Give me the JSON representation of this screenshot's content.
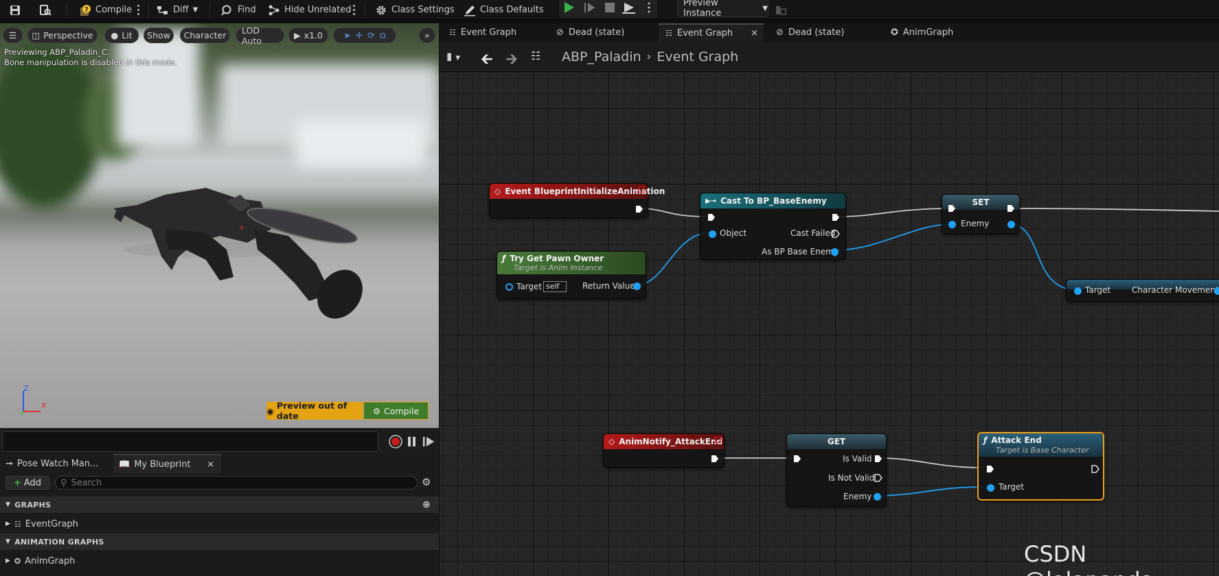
{
  "toolbar": {
    "compile_label": "Compile",
    "diff_label": "Diff",
    "find_label": "Find",
    "hide_unrelated_label": "Hide Unrelated",
    "class_settings_label": "Class Settings",
    "class_defaults_label": "Class Defaults",
    "preview_instance_label": "Preview Instance"
  },
  "viewport": {
    "perspective_label": "Perspective",
    "lit_label": "Lit",
    "show_label": "Show",
    "character_label": "Character",
    "lod_label": "LOD Auto",
    "speed_label": "x1.0",
    "preview_line1": "Previewing ABP_Paladin_C.",
    "preview_line2": "Bone manipulation is disabled in this mode.",
    "axis_z": "Z",
    "axis_x": "X",
    "preview_out_of_date": "Preview out of date",
    "compile_label": "Compile"
  },
  "left_panel": {
    "tabs": [
      {
        "label": "Pose Watch Man..."
      },
      {
        "label": "My Blueprint"
      }
    ],
    "add_label": "Add",
    "search_placeholder": "Search",
    "sections": [
      {
        "title": "GRAPHS",
        "items": [
          {
            "label": "EventGraph"
          }
        ]
      },
      {
        "title": "ANIMATION GRAPHS",
        "items": [
          {
            "label": "AnimGraph"
          }
        ]
      }
    ]
  },
  "graph": {
    "tabs": [
      {
        "label": "Event Graph"
      },
      {
        "label": "Dead (state)"
      },
      {
        "label": "Event Graph"
      },
      {
        "label": "Dead (state)"
      },
      {
        "label": "AnimGraph"
      }
    ],
    "breadcrumb": {
      "root": "ABP_Paladin",
      "current": "Event Graph"
    },
    "nodes": {
      "event_init": {
        "title": "Event BlueprintInitializeAnimation"
      },
      "try_get_pawn": {
        "title": "Try Get Pawn Owner",
        "subtitle": "Target is Anim Instance",
        "target_label": "Target",
        "target_value": "self",
        "return_label": "Return Value"
      },
      "cast": {
        "title": "Cast To BP_BaseEnemy",
        "object_label": "Object",
        "cast_failed_label": "Cast Failed",
        "as_label": "As BP Base Enemy"
      },
      "set": {
        "title": "SET",
        "enemy_label": "Enemy"
      },
      "char_move": {
        "target_label": "Target",
        "output_label": "Character Movement"
      },
      "anim_notify": {
        "title": "AnimNotify_AttackEnd"
      },
      "get": {
        "title": "GET",
        "is_valid_label": "Is Valid",
        "is_not_valid_label": "Is Not Valid",
        "enemy_label": "Enemy"
      },
      "attack_end": {
        "title": "Attack End",
        "subtitle": "Target is Base Character",
        "target_label": "Target"
      }
    }
  },
  "watermark": "CSDN @lalapanda",
  "colors": {
    "accent_orange": "#f0a21b",
    "event_red": "#b51a1a",
    "pure_green": "#4a7a3a",
    "cast_teal": "#1a6f7a",
    "var_blue": "#21a1f1",
    "play_green": "#37b34a"
  }
}
